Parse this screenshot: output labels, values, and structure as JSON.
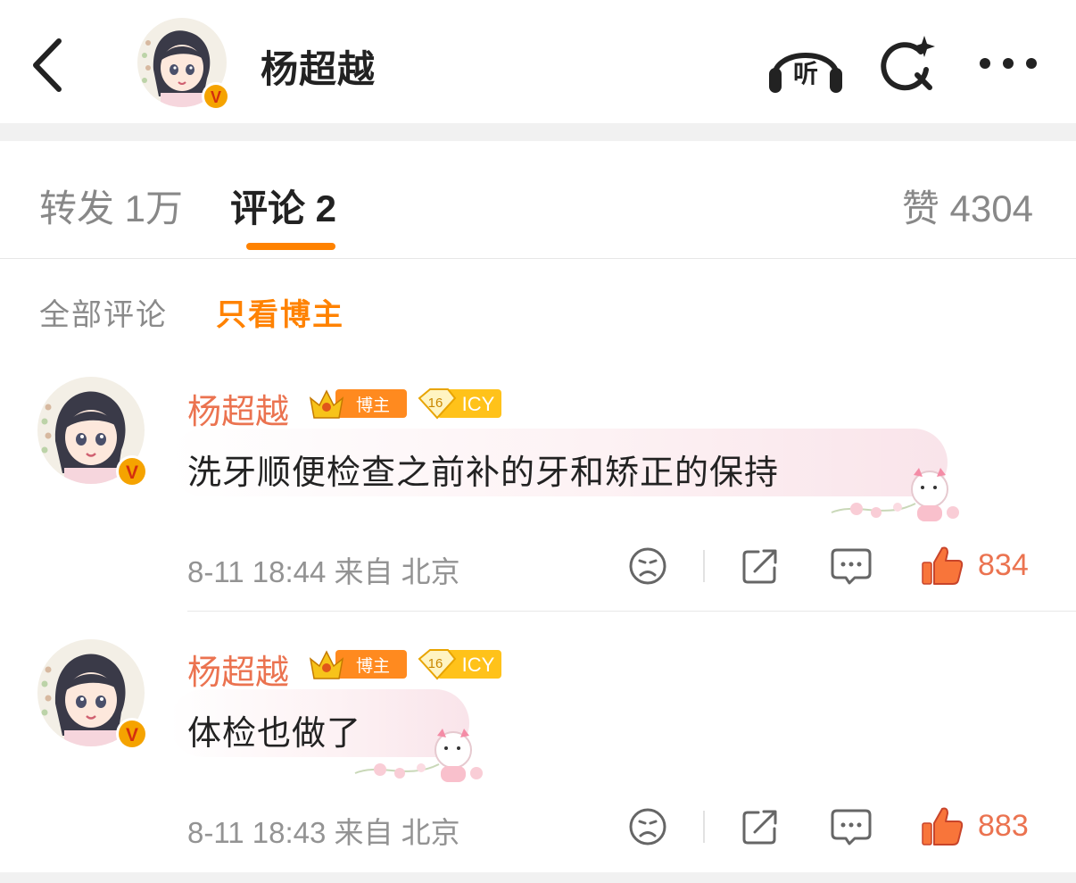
{
  "header": {
    "title": "杨超越",
    "listen_label": "听",
    "verified_mark": "V"
  },
  "tabs": {
    "repost": "转发 1万",
    "comments": "评论 2",
    "likes": "赞 4304"
  },
  "filter": {
    "all": "全部评论",
    "blogger_only": "只看博主"
  },
  "badges": {
    "blogger": "博主",
    "level_number": "16",
    "level_tag": "ICY"
  },
  "comments": [
    {
      "name": "杨超越",
      "text": "洗牙顺便检查之前补的牙和矫正的保持",
      "meta": "8-11 18:44  来自 北京",
      "likes": "834"
    },
    {
      "name": "杨超越",
      "text": "体检也做了",
      "meta": "8-11 18:43  来自 北京",
      "likes": "883"
    }
  ],
  "colors": {
    "accent": "#ff8200",
    "name": "#eb7350",
    "verified": "#f5a300",
    "muted": "#939393"
  },
  "icons": {
    "back": "chevron-left-icon",
    "listen": "headphones-icon",
    "search": "search-sparkle-icon",
    "more": "more-dots-icon",
    "emoji": "sad-face-icon",
    "share": "share-icon",
    "comment": "comment-icon",
    "like": "thumbs-up-icon"
  }
}
